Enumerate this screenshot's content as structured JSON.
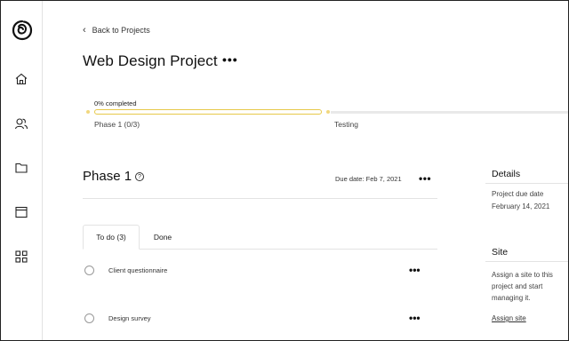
{
  "sidebar": {
    "logo": "godaddy-logo",
    "items": [
      {
        "icon": "home-icon"
      },
      {
        "icon": "people-icon"
      },
      {
        "icon": "folder-icon"
      },
      {
        "icon": "browser-window-icon"
      },
      {
        "icon": "apps-grid-icon"
      }
    ]
  },
  "header": {
    "back_label": "Back to Projects",
    "title": "Web Design Project",
    "more": "•••"
  },
  "progress": {
    "label": "0% completed",
    "percent": 0,
    "phase_label": "Phase 1 (0/3)",
    "next_label": "Testing",
    "accent": "#e7c94a"
  },
  "phase": {
    "title": "Phase 1",
    "help": "?",
    "due": "Due date: Feb 7, 2021",
    "more": "•••"
  },
  "tabs": [
    {
      "label": "To do (3)",
      "active": true
    },
    {
      "label": "Done",
      "active": false
    }
  ],
  "tasks": [
    {
      "name": "Client questionnaire",
      "more": "•••"
    },
    {
      "name": "Design survey",
      "more": "•••"
    }
  ],
  "details": {
    "heading": "Details",
    "due_label": "Project due date",
    "due_value": "February 14, 2021"
  },
  "site": {
    "heading": "Site",
    "description": "Assign a site to this project and start managing it.",
    "link": "Assign site"
  }
}
